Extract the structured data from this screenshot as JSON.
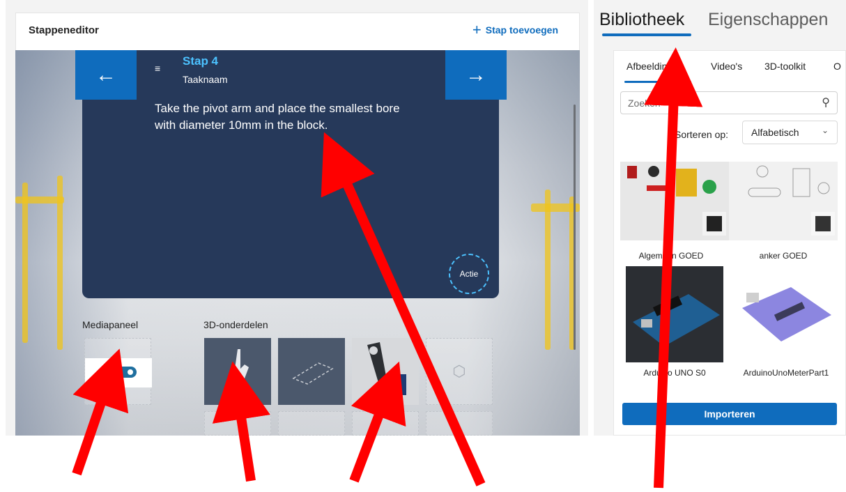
{
  "editor": {
    "title": "Stappeneditor",
    "add_step_label": "Stap toevoegen",
    "prev_icon": "arrow-left-icon",
    "next_icon": "arrow-right-icon"
  },
  "step": {
    "title": "Stap 4",
    "subtitle": "Taaknaam",
    "text": "Take the pivot arm and place the smallest bore with diameter 10mm in the block.",
    "action_label": "Actie"
  },
  "media_panel": {
    "label": "Mediapaneel"
  },
  "parts_panel": {
    "label": "3D-onderdelen"
  },
  "right": {
    "tabs": [
      "Bibliotheek",
      "Eigenschappen"
    ],
    "subtabs": [
      "Afbeeldingen",
      "Video's",
      "3D-toolkit",
      "O"
    ],
    "search_placeholder": "Zoeken",
    "sort_label": "Sorteren op:",
    "sort_value": "Alfabetisch",
    "items": [
      "Algemeen GOED",
      "anker GOED",
      "Arduino UNO S0",
      "ArduinoUnoMeterPart1"
    ],
    "import_label": "Importeren"
  },
  "colors": {
    "accent": "#0f6cbd",
    "card": "#26395a",
    "highlight": "#4cc2ff",
    "arrow": "#ff0000"
  }
}
